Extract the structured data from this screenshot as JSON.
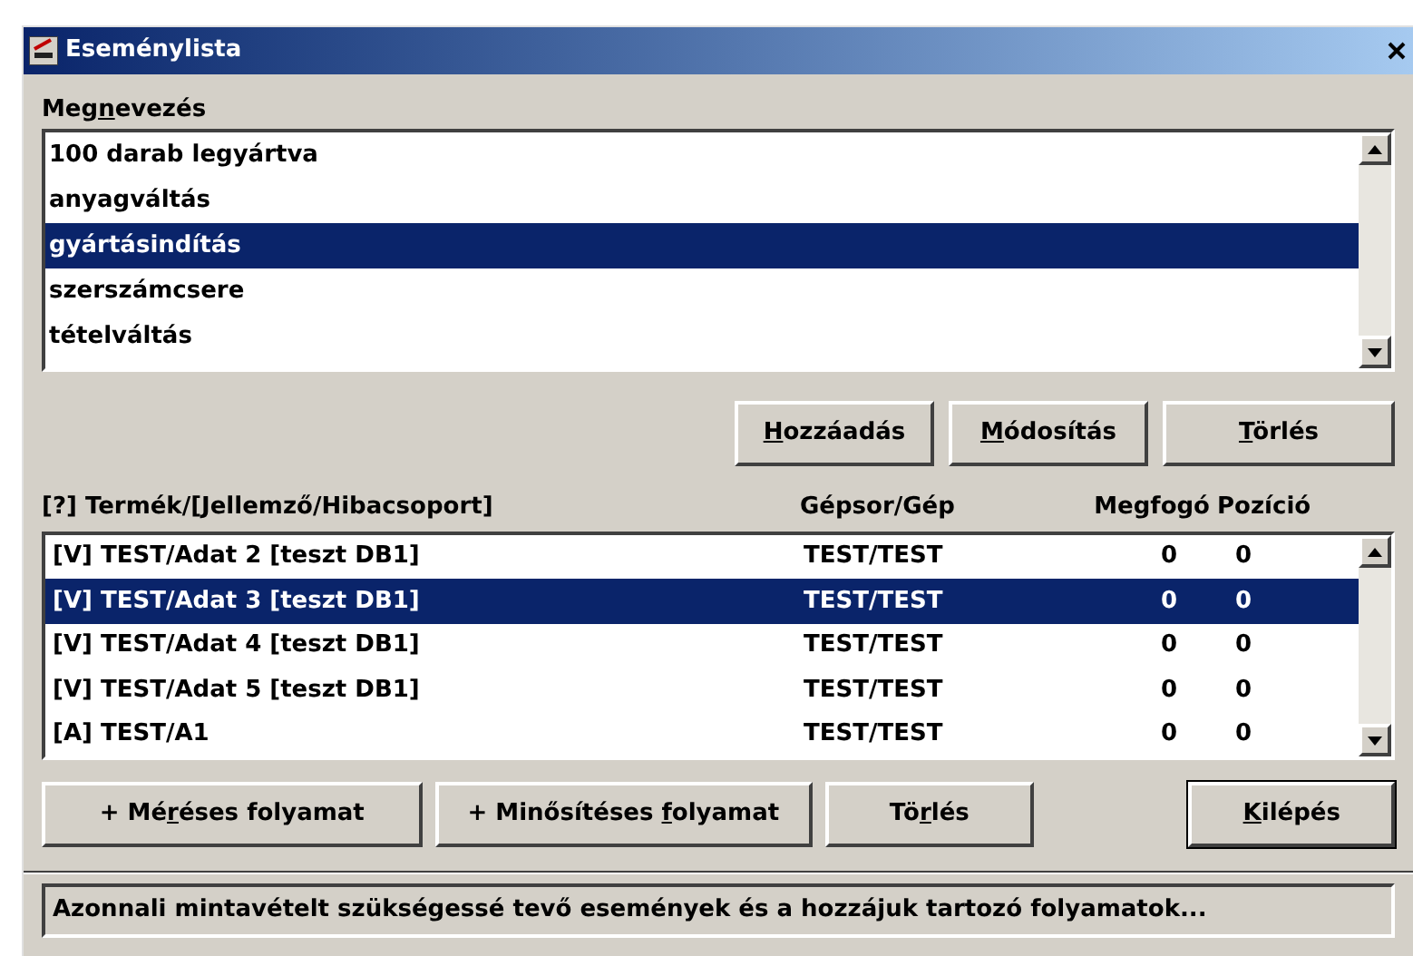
{
  "window": {
    "title": "Eseménylista"
  },
  "events": {
    "label": {
      "before": "Meg",
      "key": "n",
      "after": "evezés"
    },
    "items": [
      {
        "text": "100 darab legyártva",
        "selected": false
      },
      {
        "text": "anyagváltás",
        "selected": false
      },
      {
        "text": "gyártásindítás",
        "selected": true
      },
      {
        "text": "szerszámcsere",
        "selected": false
      },
      {
        "text": "tételváltás",
        "selected": false
      }
    ],
    "buttons": [
      {
        "key": "H",
        "after": "ozzáadás"
      },
      {
        "key": "M",
        "after": "ódosítás"
      },
      {
        "key": "T",
        "after": "örlés"
      }
    ]
  },
  "processes": {
    "columns": [
      "[?] Termék/[Jellemző/Hibacsoport]",
      "Gépsor/Gép",
      "Megfogó",
      "Pozíció"
    ],
    "rows": [
      {
        "cells": [
          "[V] TEST/Adat 2 [teszt DB1]",
          "TEST/TEST",
          "0",
          "0"
        ],
        "selected": false
      },
      {
        "cells": [
          "[V] TEST/Adat 3 [teszt DB1]",
          "TEST/TEST",
          "0",
          "0"
        ],
        "selected": true
      },
      {
        "cells": [
          "[V] TEST/Adat 4 [teszt DB1]",
          "TEST/TEST",
          "0",
          "0"
        ],
        "selected": false
      },
      {
        "cells": [
          "[V] TEST/Adat 5 [teszt DB1]",
          "TEST/TEST",
          "0",
          "0"
        ],
        "selected": false
      },
      {
        "cells": [
          "[A] TEST/A1",
          "TEST/TEST",
          "0",
          "0"
        ],
        "selected": false
      }
    ],
    "buttons": [
      {
        "before": "+ Mé",
        "key": "r",
        "after": "éses folyamat",
        "default": false
      },
      {
        "before": "+ Minősítéses ",
        "key": "f",
        "after": "olyamat",
        "default": false
      },
      {
        "before": "Tö",
        "key": "r",
        "after": "lés",
        "default": false
      },
      {
        "key": "K",
        "after": "ilépés",
        "default": true
      }
    ]
  },
  "status_bar": "Azonnali mintavételt szükségessé tevő események és a hozzájuk tartozó folyamatok..."
}
